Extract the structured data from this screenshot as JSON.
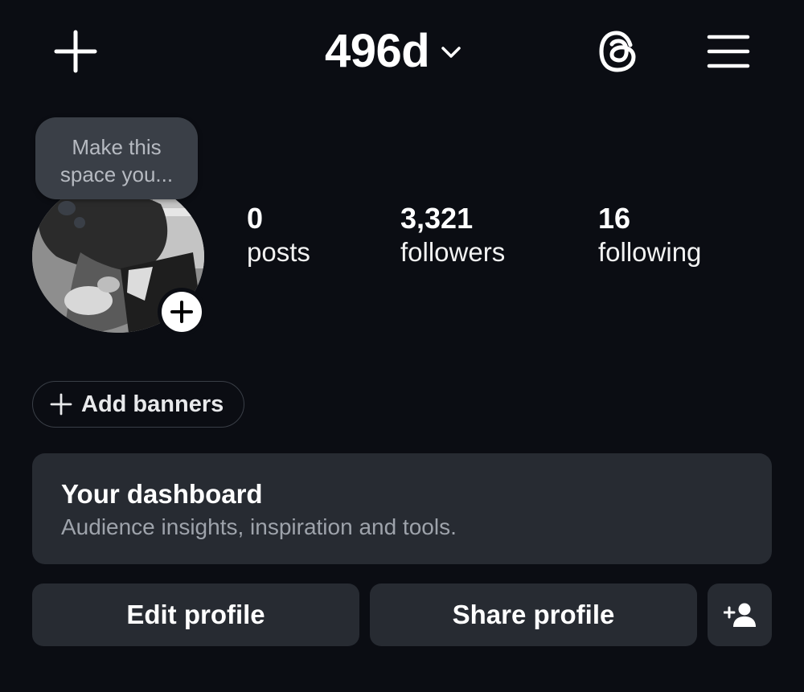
{
  "header": {
    "username": "496d"
  },
  "note": {
    "text": "Make this\nspace you..."
  },
  "stats": [
    {
      "value": "0",
      "label": "posts"
    },
    {
      "value": "3,321",
      "label": "followers"
    },
    {
      "value": "16",
      "label": "following"
    }
  ],
  "banners": {
    "label": "Add banners"
  },
  "dashboard": {
    "title": "Your dashboard",
    "subtitle": "Audience insights, inspiration and tools."
  },
  "actions": {
    "edit_label": "Edit profile",
    "share_label": "Share profile"
  },
  "icons": {
    "create": "plus-icon",
    "username_dropdown": "chevron-down-icon",
    "threads": "threads-icon",
    "menu": "hamburger-menu-icon",
    "add_photo": "plus-circle-icon",
    "add_banner": "plus-icon",
    "discover_people": "add-person-icon"
  },
  "colors": {
    "background": "#0b0d13",
    "surface": "#272b32",
    "note_bubble": "#3a3f47",
    "secondary_text": "#9ea3ab"
  }
}
